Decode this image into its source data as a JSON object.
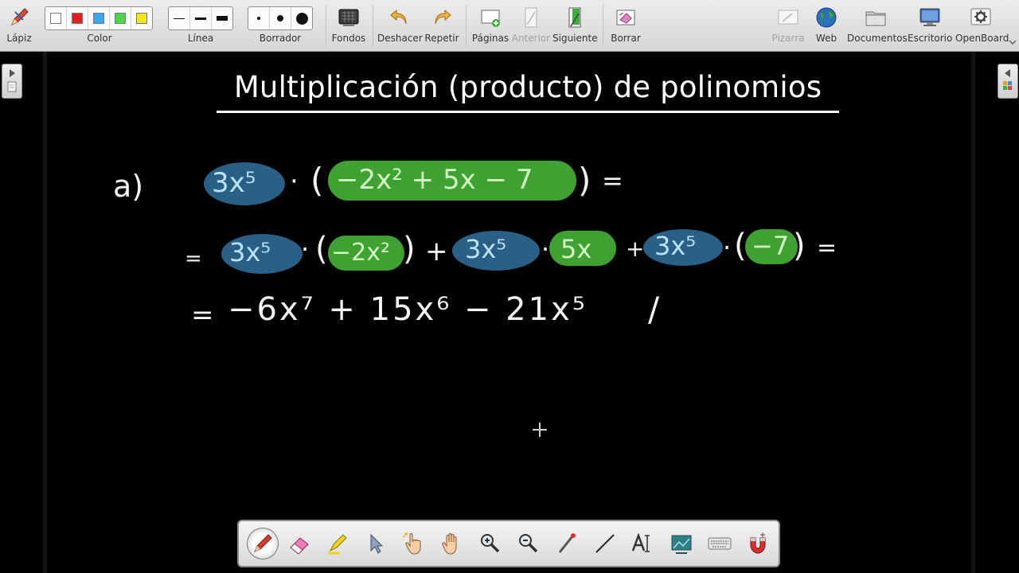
{
  "toolbar": {
    "pencil_label": "Lápiz",
    "color_label": "Color",
    "line_label": "Línea",
    "eraser_label": "Borrador",
    "backgrounds_label": "Fondos",
    "undo_label": "Deshacer",
    "redo_label": "Repetir",
    "pages_label": "Páginas",
    "previous_label": "Anterior",
    "next_label": "Siguiente",
    "clear_label": "Borrar",
    "board_label": "Pizarra",
    "web_label": "Web",
    "documents_label": "Documentos",
    "desktop_label": "Escritorio",
    "openboard_label": "OpenBoard",
    "colors": [
      "#ffffff",
      "#e02020",
      "#3aa7f0",
      "#4cd64c",
      "#f2e61a"
    ]
  },
  "board": {
    "title": "Multiplicación (producto) de polinomios",
    "line1": {
      "label": "a)",
      "monomial": "3x⁵",
      "dot": "·",
      "open_paren": "(",
      "polynomial": "−2x² + 5x − 7",
      "close_paren": ")",
      "equals": "="
    },
    "line2": {
      "equals_start": "=",
      "term1_blue": "3x⁵",
      "dot": "·",
      "term1_green": "−2x²",
      "plus": "+",
      "term2_blue": "3x⁵",
      "term2_green": "5x",
      "term3_blue": "3x⁵",
      "term3_green": "−7",
      "open_paren": "(",
      "close_paren": ")",
      "equals_end": "="
    },
    "line3": {
      "equals": "=",
      "result": "−6x⁷ + 15x⁶ − 21x⁵",
      "mark": "/"
    }
  },
  "palette": {
    "tools": [
      "pen-icon",
      "eraser-icon",
      "highlighter-icon",
      "selector-icon",
      "interactor-icon",
      "hand-icon",
      "zoom-in-icon",
      "zoom-out-icon",
      "laser-pointer-icon",
      "line-icon",
      "text-icon",
      "capture-icon",
      "keyboard-icon",
      "magnet-icon"
    ]
  }
}
